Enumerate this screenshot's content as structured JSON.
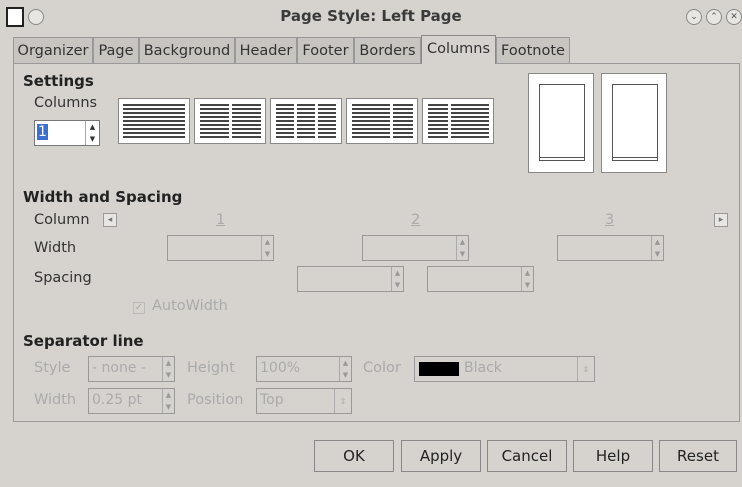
{
  "window": {
    "title": "Page Style: Left Page"
  },
  "tabs": [
    {
      "label": "Organizer"
    },
    {
      "label": "Page"
    },
    {
      "label": "Background"
    },
    {
      "label": "Header"
    },
    {
      "label": "Footer"
    },
    {
      "label": "Borders"
    },
    {
      "label": "Columns"
    },
    {
      "label": "Footnote"
    }
  ],
  "settings": {
    "title": "Settings",
    "columns_label": "Columns",
    "columns_value": "1"
  },
  "width_spacing": {
    "title": "Width and Spacing",
    "column_label": "Column",
    "col_numbers": [
      "1",
      "2",
      "3"
    ],
    "width_label": "Width",
    "spacing_label": "Spacing",
    "autowidth_label": "AutoWidth"
  },
  "separator": {
    "title": "Separator line",
    "style_label": "Style",
    "style_value": "- none -",
    "height_label": "Height",
    "height_value": "100%",
    "color_label": "Color",
    "color_value": "Black",
    "color_swatch": "#000000",
    "width_label": "Width",
    "width_value": "0.25 pt",
    "position_label": "Position",
    "position_value": "Top"
  },
  "buttons": {
    "ok": "OK",
    "apply": "Apply",
    "cancel": "Cancel",
    "help": "Help",
    "reset": "Reset"
  },
  "icons": {
    "app": "document-icon",
    "minimize": "minimize-icon",
    "maximize": "maximize-icon",
    "close": "close-icon",
    "prev": "arrow-left-icon",
    "next": "arrow-right-icon"
  }
}
